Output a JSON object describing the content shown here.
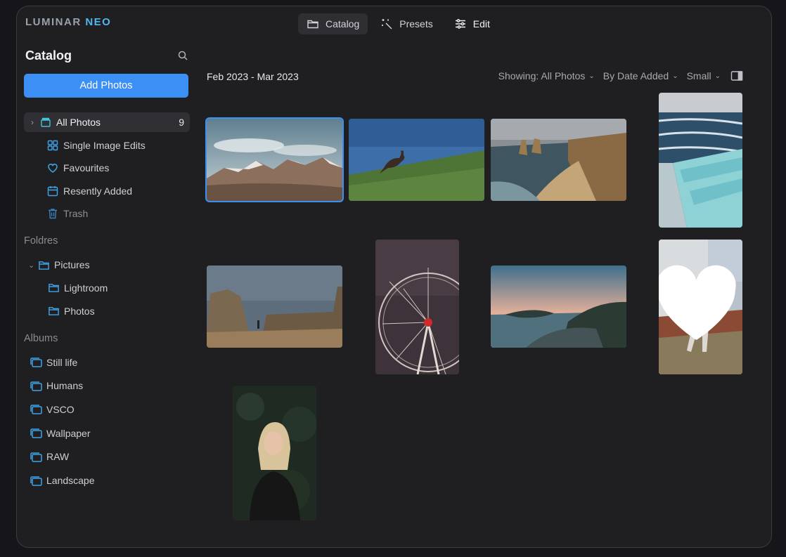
{
  "app": {
    "logo_main": "LUMINAR",
    "logo_accent": "NEO"
  },
  "topnav": [
    {
      "label": "Catalog",
      "icon": "folder-icon"
    },
    {
      "label": "Presets",
      "icon": "magic-wand-icon"
    },
    {
      "label": "Edit",
      "icon": "sliders-icon"
    }
  ],
  "sidebar": {
    "title": "Catalog",
    "add_button": "Add Photos",
    "items": [
      {
        "label": "All Photos",
        "count": "9",
        "icon": "all-photos-icon"
      },
      {
        "label": "Single Image Edits",
        "icon": "grid-icon"
      },
      {
        "label": "Favourites",
        "icon": "heart-icon"
      },
      {
        "label": "Resently Added",
        "icon": "calendar-icon"
      },
      {
        "label": "Trash",
        "icon": "trash-icon"
      }
    ],
    "folders_label": "Foldres",
    "folders": [
      {
        "label": "Pictures",
        "level": 0
      },
      {
        "label": "Lightroom",
        "level": 1
      },
      {
        "label": "Photos",
        "level": 1
      }
    ],
    "albums_label": "Albums",
    "albums": [
      "Still life",
      "Humans",
      "VSCO",
      "Wallpaper",
      "RAW",
      "Landscape"
    ]
  },
  "main": {
    "date_range": "Feb 2023 - Mar 2023",
    "showing": "Showing: All Photos",
    "sort": "By Date Added",
    "size": "Small"
  },
  "colors": {
    "accent": "#3b8ff5",
    "logo_accent": "#4fb6f0",
    "background": "#1f1f22"
  },
  "photos": [
    {
      "subject": "snowy mountains",
      "selected": true,
      "favourite": false
    },
    {
      "subject": "kangaroo on grass",
      "selected": false,
      "favourite": false
    },
    {
      "subject": "coastal cliffs",
      "selected": false,
      "favourite": false
    },
    {
      "subject": "ocean pool",
      "selected": false,
      "favourite": false
    },
    {
      "subject": "rock formations beach",
      "selected": false,
      "favourite": false
    },
    {
      "subject": "ferris wheel",
      "selected": false,
      "favourite": false
    },
    {
      "subject": "rocky coast sunset",
      "selected": false,
      "favourite": false
    },
    {
      "subject": "woman by wall",
      "selected": false,
      "favourite": true
    },
    {
      "subject": "smiling woman portrait",
      "selected": false,
      "favourite": false
    }
  ]
}
